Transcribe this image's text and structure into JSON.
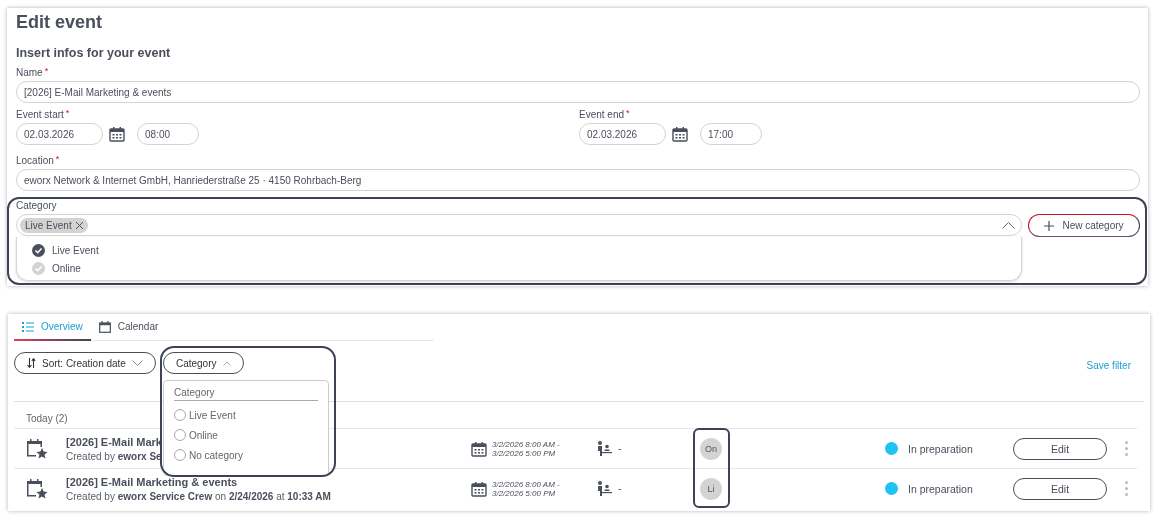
{
  "edit_event": {
    "title": "Edit event",
    "subtitle": "Insert infos for your event",
    "name": {
      "label": "Name",
      "required_mark": "*",
      "value": "[2026] E-Mail Marketing & events"
    },
    "event_start": {
      "label": "Event start",
      "required_mark": "*",
      "date": "02.03.2026",
      "time": "08:00"
    },
    "event_end": {
      "label": "Event end",
      "required_mark": "*",
      "date": "02.03.2026",
      "time": "17:00"
    },
    "location": {
      "label": "Location",
      "required_mark": "*",
      "value": "eworx Network & Internet GmbH, Hanriederstraße 25 · 4150 Rohrbach-Berg"
    },
    "category": {
      "label": "Category",
      "tags": [
        "Live Event"
      ],
      "expanded": true,
      "new_button": "New category",
      "options": [
        {
          "label": "Live Event",
          "selected": true
        },
        {
          "label": "Online",
          "selected": false
        }
      ]
    }
  },
  "events_view": {
    "tabs": [
      {
        "label": "Overview",
        "selected": true
      },
      {
        "label": "Calendar",
        "selected": false
      }
    ],
    "sort_button": "Sort: Creation date",
    "save_filter": "Save filter",
    "category_filter": {
      "label": "Category",
      "expanded": true,
      "heading": "Category",
      "options": [
        {
          "label": "Live Event",
          "selected": false
        },
        {
          "label": "Online",
          "selected": false
        },
        {
          "label": "No category",
          "selected": false
        }
      ]
    },
    "group": "Today (2)",
    "rows": [
      {
        "title": "[2026] E-Mail Mark",
        "created": "Created by **eworx Se**",
        "dates": [
          "3/2/2026 8:00 AM -",
          "3/2/2026 5:00 PM"
        ],
        "participants": "-",
        "avatar": "On",
        "status": "In preparation",
        "color": "#1ec3f5",
        "edit": "Edit"
      },
      {
        "title": "[2026] E-Mail Marketing & events",
        "created": "Created by **eworx Service Crew** on **2/24/2026** at **10:33 AM**",
        "dates": [
          "3/2/2026 8:00 AM -",
          "3/2/2026 5:00 PM"
        ],
        "participants": "-",
        "avatar": "Li",
        "status": "In preparation",
        "color": "#1ec3f5",
        "edit": "Edit"
      }
    ]
  }
}
